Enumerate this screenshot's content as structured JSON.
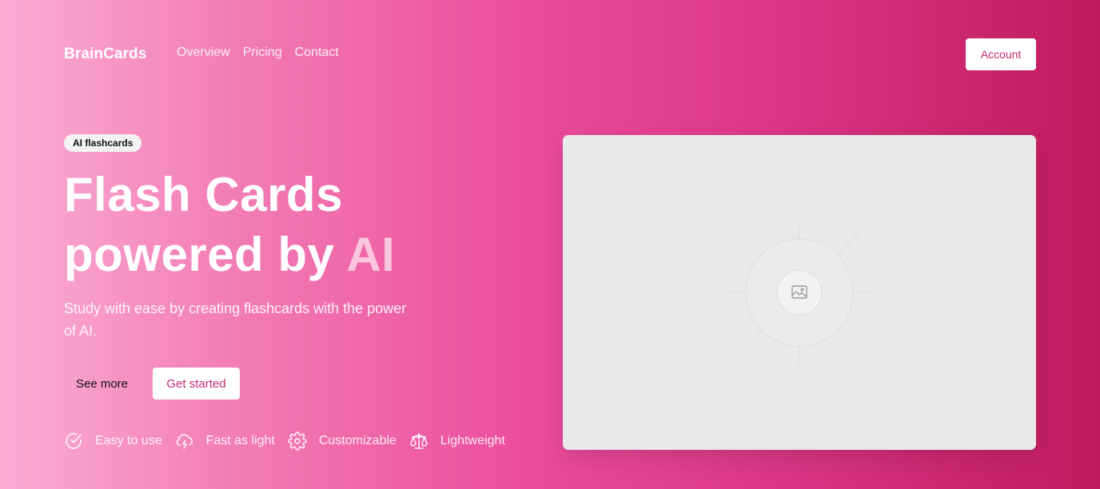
{
  "nav": {
    "brand": "BrainCards",
    "links": [
      "Overview",
      "Pricing",
      "Contact"
    ],
    "account_label": "Account"
  },
  "hero": {
    "badge": "AI flashcards",
    "title_line1": "Flash Cards",
    "title_line2_prefix": "powered by ",
    "title_accent": "AI",
    "subtitle": "Study with ease by creating flashcards with the power of AI.",
    "secondary_button": "See more",
    "primary_button": "Get started"
  },
  "features": [
    {
      "icon": "check-circle-icon",
      "label": "Easy to use"
    },
    {
      "icon": "cloud-lightning-icon",
      "label": "Fast as light"
    },
    {
      "icon": "gear-icon",
      "label": "Customizable"
    },
    {
      "icon": "scale-icon",
      "label": "Lightweight"
    }
  ],
  "image": {
    "icon": "image-placeholder-icon"
  },
  "colors": {
    "accent_text": "#c02a72",
    "accent_highlight": "#f9c6dd",
    "gradient_start": "#fbadd4",
    "gradient_mid": "#ec4c9c",
    "gradient_end": "#c01b5e",
    "placeholder_bg": "#e9e9e9"
  }
}
